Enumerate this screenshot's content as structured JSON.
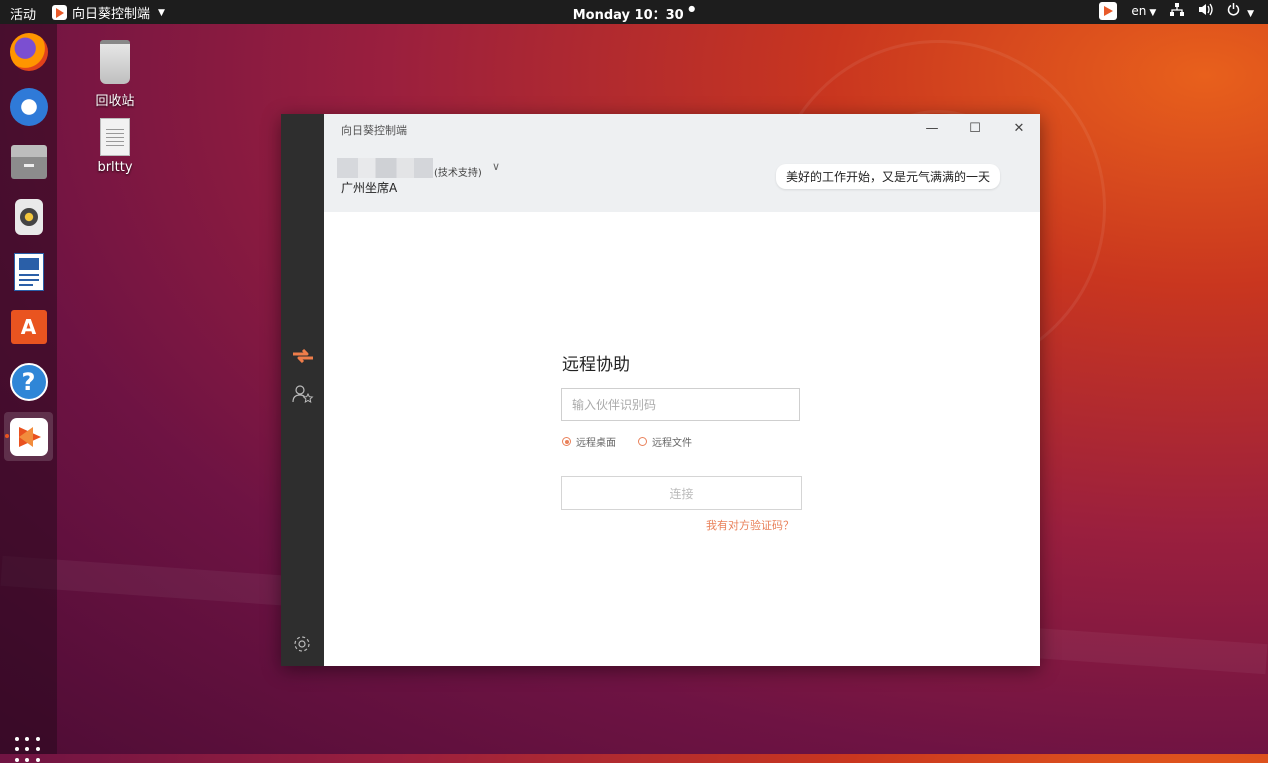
{
  "topbar": {
    "activities": "活动",
    "app_name": "向日葵控制端",
    "clock": "Monday 10：30",
    "language": "en"
  },
  "dock": {
    "items": [
      "firefox-icon",
      "thunderbird-icon",
      "files-icon",
      "rhythmbox-icon",
      "libreoffice-writer-icon",
      "software-center-icon",
      "help-icon",
      "sunlogin-icon"
    ]
  },
  "desktop": {
    "icons": [
      {
        "label": "回收站",
        "icon": "trash-icon"
      },
      {
        "label": "brltty",
        "icon": "document-icon"
      }
    ]
  },
  "window": {
    "title": "向日葵控制端",
    "user_role": "(技术支持)",
    "user_group": "广州坐席A",
    "greeting": "美好的工作开始，又是元气满满的一天",
    "panel": {
      "title": "远程协助",
      "input_placeholder": "输入伙伴识别码",
      "input_value": "",
      "options": [
        {
          "label": "远程桌面",
          "selected": true
        },
        {
          "label": "远程文件",
          "selected": false
        }
      ],
      "connect_label": "连接",
      "verify_link": "我有对方验证码？"
    }
  },
  "colors": {
    "accent": "#e9815a",
    "sidebar": "#2e2e2e",
    "topbar": "#1d1d1d"
  }
}
